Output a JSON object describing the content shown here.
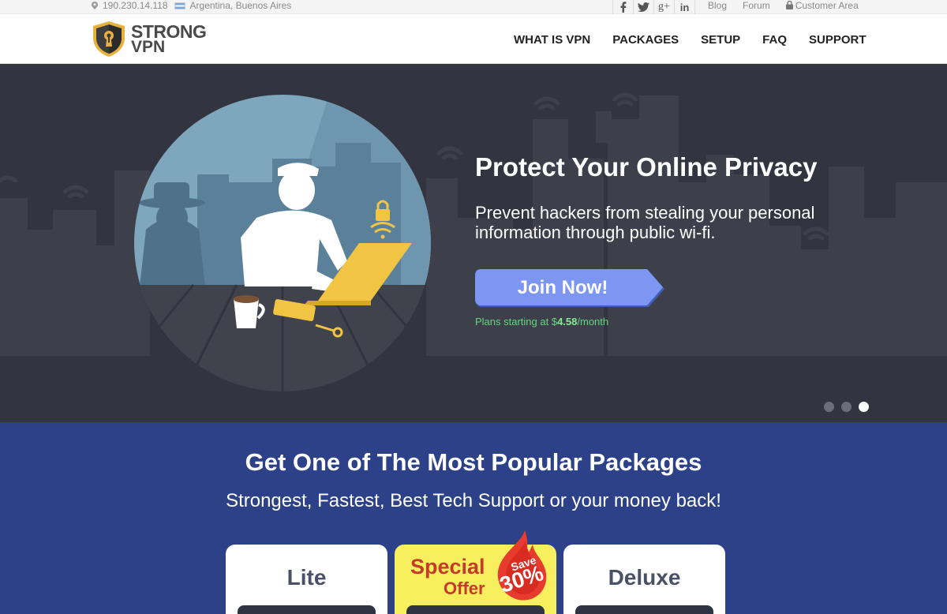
{
  "topbar": {
    "ip": "190.230.14.118",
    "location": "Argentina, Buenos Aires",
    "social": [
      {
        "icon": "facebook-icon",
        "glyph": "f"
      },
      {
        "icon": "twitter-icon",
        "glyph": "t"
      },
      {
        "icon": "google-plus-icon",
        "glyph": "g+"
      },
      {
        "icon": "linkedin-icon",
        "glyph": "in"
      }
    ],
    "links": {
      "blog": "Blog",
      "forum": "Forum",
      "customer_area": "Customer Area"
    }
  },
  "header": {
    "logo_line1": "STRONG",
    "logo_line2": "VPN",
    "nav": [
      "WHAT IS VPN",
      "PACKAGES",
      "SETUP",
      "FAQ",
      "SUPPORT"
    ]
  },
  "hero": {
    "title": "Protect Your Online Privacy",
    "subtitle": "Prevent hackers from stealing your personal information through public wi-fi.",
    "cta": "Join Now!",
    "plans_prefix": "Plans starting at $",
    "plans_price": "4.58",
    "plans_suffix": "/month",
    "slides": 3,
    "active_slide": 3
  },
  "packages": {
    "title": "Get One of The Most Popular Packages",
    "subtitle": "Strongest, Fastest, Best Tech Support or your money back!",
    "cards": {
      "lite": "Lite",
      "special_line1": "Special",
      "special_line2": "Offer",
      "save_label": "Save",
      "save_value": "30%",
      "deluxe": "Deluxe"
    }
  },
  "colors": {
    "hero_bg": "#32353f",
    "packages_bg": "#2d4189",
    "cta": "#6b8cf0",
    "accent_green": "#66d47e",
    "special_yellow": "#f8ef5f",
    "offer_red": "#c53a2b"
  }
}
